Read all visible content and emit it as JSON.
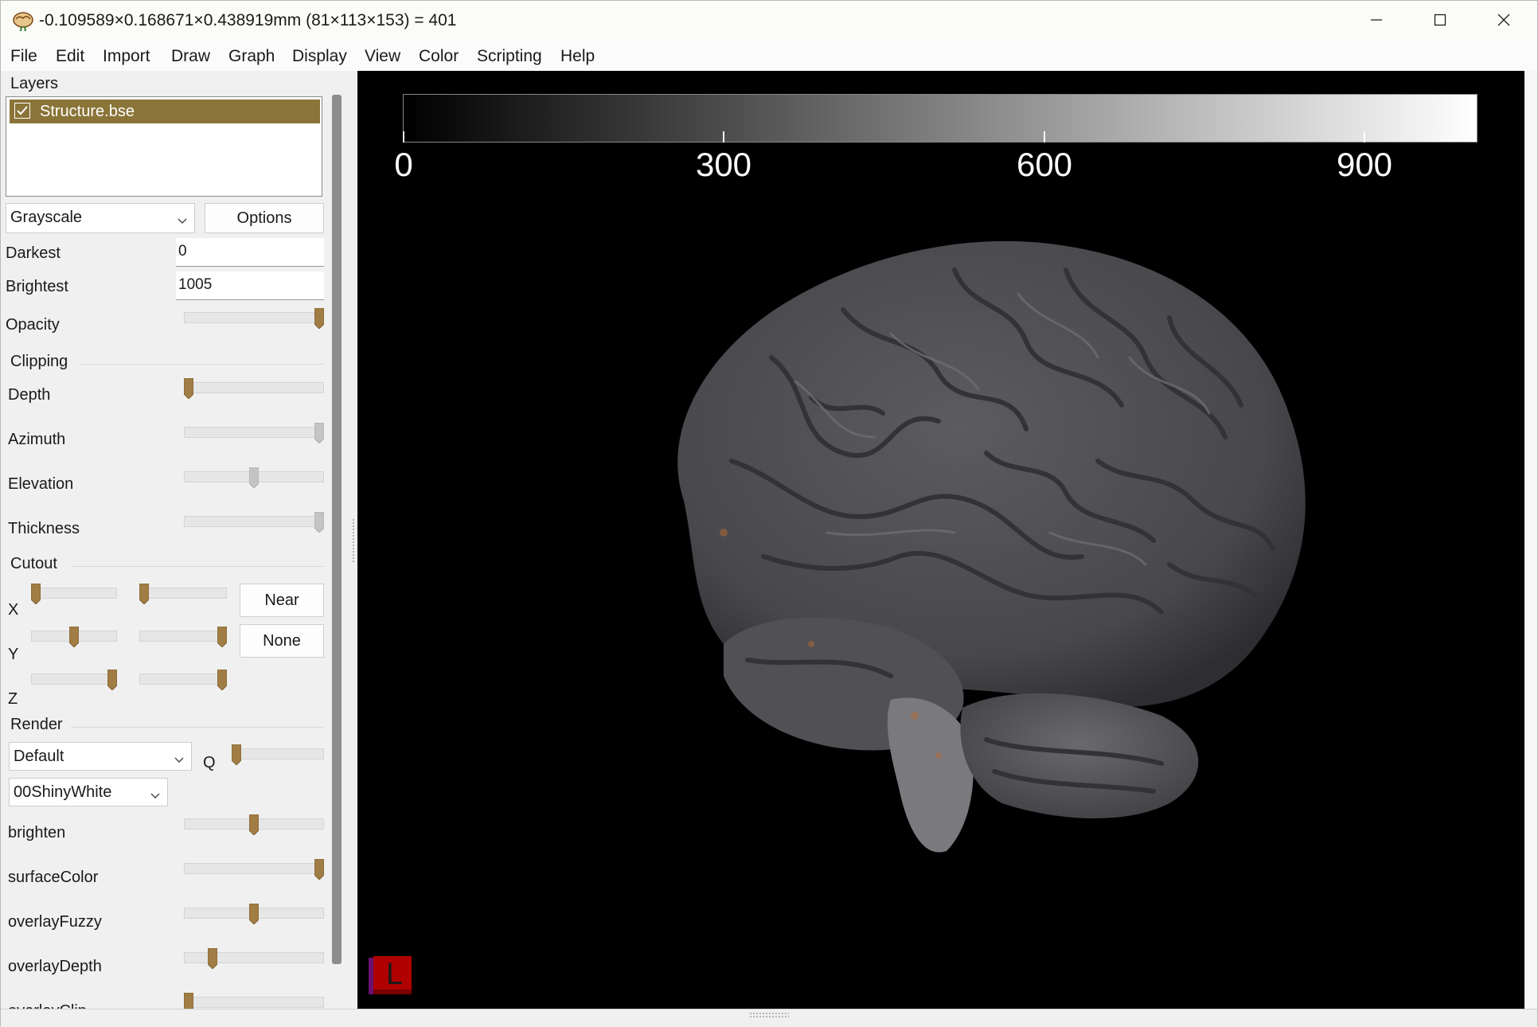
{
  "window": {
    "title": "-0.109589×0.168671×0.438919mm (81×113×153) =  401"
  },
  "menu": [
    "File",
    "Edit",
    "Import",
    "Draw",
    "Graph",
    "Display",
    "View",
    "Color",
    "Scripting",
    "Help"
  ],
  "layers": {
    "header": "Layers",
    "items": [
      {
        "name": "Structure.bse",
        "checked": true
      }
    ]
  },
  "colorscheme": {
    "selected": "Grayscale",
    "options_button": "Options"
  },
  "intensity": {
    "darkest_label": "Darkest",
    "darkest_value": "0",
    "brightest_label": "Brightest",
    "brightest_value": "1005",
    "opacity_label": "Opacity",
    "opacity_level": 1.0
  },
  "clipping": {
    "header": "Clipping",
    "depth_label": "Depth",
    "depth_level": 0.0,
    "azimuth_label": "Azimuth",
    "azimuth_level": 1.0,
    "elevation_label": "Elevation",
    "elevation_level": 0.5,
    "thickness_label": "Thickness",
    "thickness_level": 1.0
  },
  "cutout": {
    "header": "Cutout",
    "x_label": "X",
    "y_label": "Y",
    "z_label": "Z",
    "near_button": "Near",
    "none_button": "None",
    "x_levels": [
      0.0,
      0.0
    ],
    "y_levels": [
      0.5,
      1.0
    ],
    "z_levels": [
      1.0,
      1.0
    ]
  },
  "render": {
    "header": "Render",
    "mode_selected": "Default",
    "q_label": "Q",
    "q_level": 0.0,
    "shader_selected": "00ShinyWhite",
    "brighten_label": "brighten",
    "brighten_level": 0.5,
    "surfaceColor_label": "surfaceColor",
    "surfaceColor_level": 1.0,
    "overlayFuzzy_label": "overlayFuzzy",
    "overlayFuzzy_level": 0.5,
    "overlayDepth_label": "overlayDepth",
    "overlayDepth_level": 0.18,
    "overlayClip_label": "overlayClip",
    "overlayClip_level": 0.0
  },
  "colorbar": {
    "ticks": [
      "0",
      "300",
      "600",
      "900"
    ],
    "range": [
      0,
      1005
    ]
  },
  "orientation_label": "L",
  "colors": {
    "accent": "#8a7438",
    "thumb": "#a07d45"
  }
}
